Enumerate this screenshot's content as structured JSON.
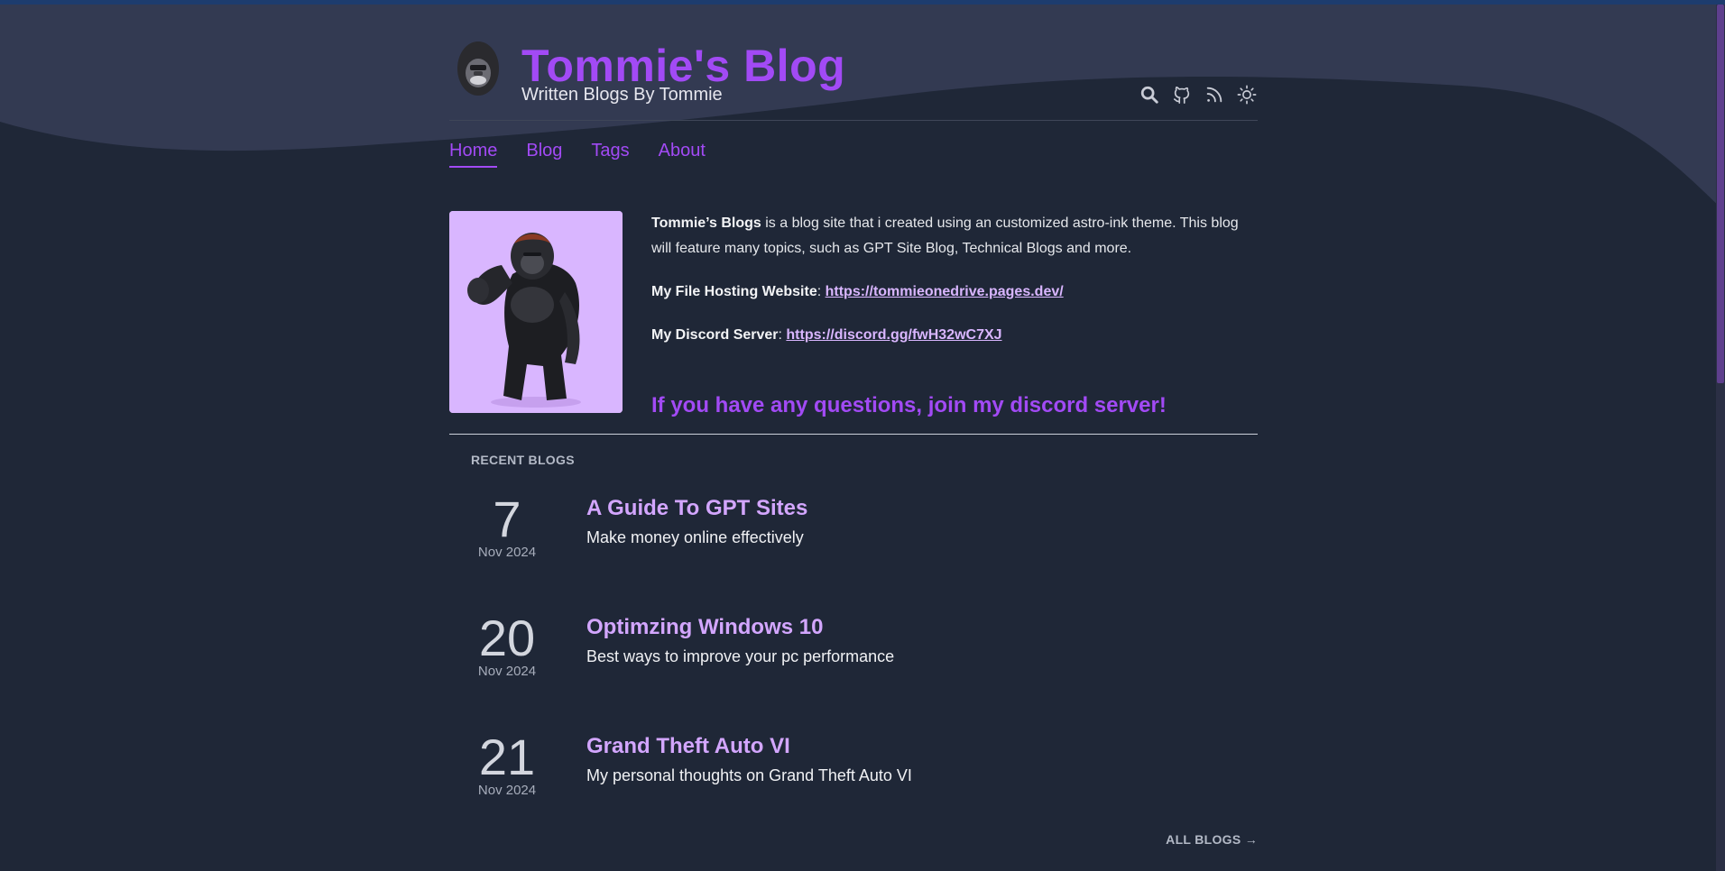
{
  "site": {
    "title": "Tommie's Blog",
    "subtitle": "Written Blogs By Tommie"
  },
  "header_icons": [
    "search-icon",
    "github-icon",
    "rss-icon",
    "sun-icon"
  ],
  "nav": {
    "home": "Home",
    "blog": "Blog",
    "tags": "Tags",
    "about": "About",
    "active": "Home"
  },
  "intro": {
    "p1_bold": "Tommie’s Blogs",
    "p1_rest": " is a blog site that i created using an customized astro-ink theme. This blog will feature many topics, such as GPT Site Blog, Technical Blogs and more.",
    "file_label": "My File Hosting Website",
    "file_sep": ": ",
    "file_url": "https://tommieonedrive.pages.dev/",
    "discord_label": "My Discord Server",
    "discord_sep": ": ",
    "discord_url": "https://discord.gg/fwH32wC7XJ",
    "cta": "If you have any questions, join my discord server!"
  },
  "recent": {
    "heading": "RECENT BLOGS",
    "posts": [
      {
        "day": "7",
        "month": "Nov 2024",
        "title": "A Guide To GPT Sites",
        "desc": "Make money online effectively"
      },
      {
        "day": "20",
        "month": "Nov 2024",
        "title": "Optimzing Windows 10",
        "desc": "Best ways to improve your pc performance"
      },
      {
        "day": "21",
        "month": "Nov 2024",
        "title": "Grand Theft Auto VI",
        "desc": "My personal thoughts on Grand Theft Auto VI"
      }
    ],
    "all_link": "ALL BLOGS →"
  },
  "colors": {
    "background": "#1f2737",
    "wave": "#333a52",
    "accent": "#a24af5",
    "link_light": "#d9b6ff"
  }
}
